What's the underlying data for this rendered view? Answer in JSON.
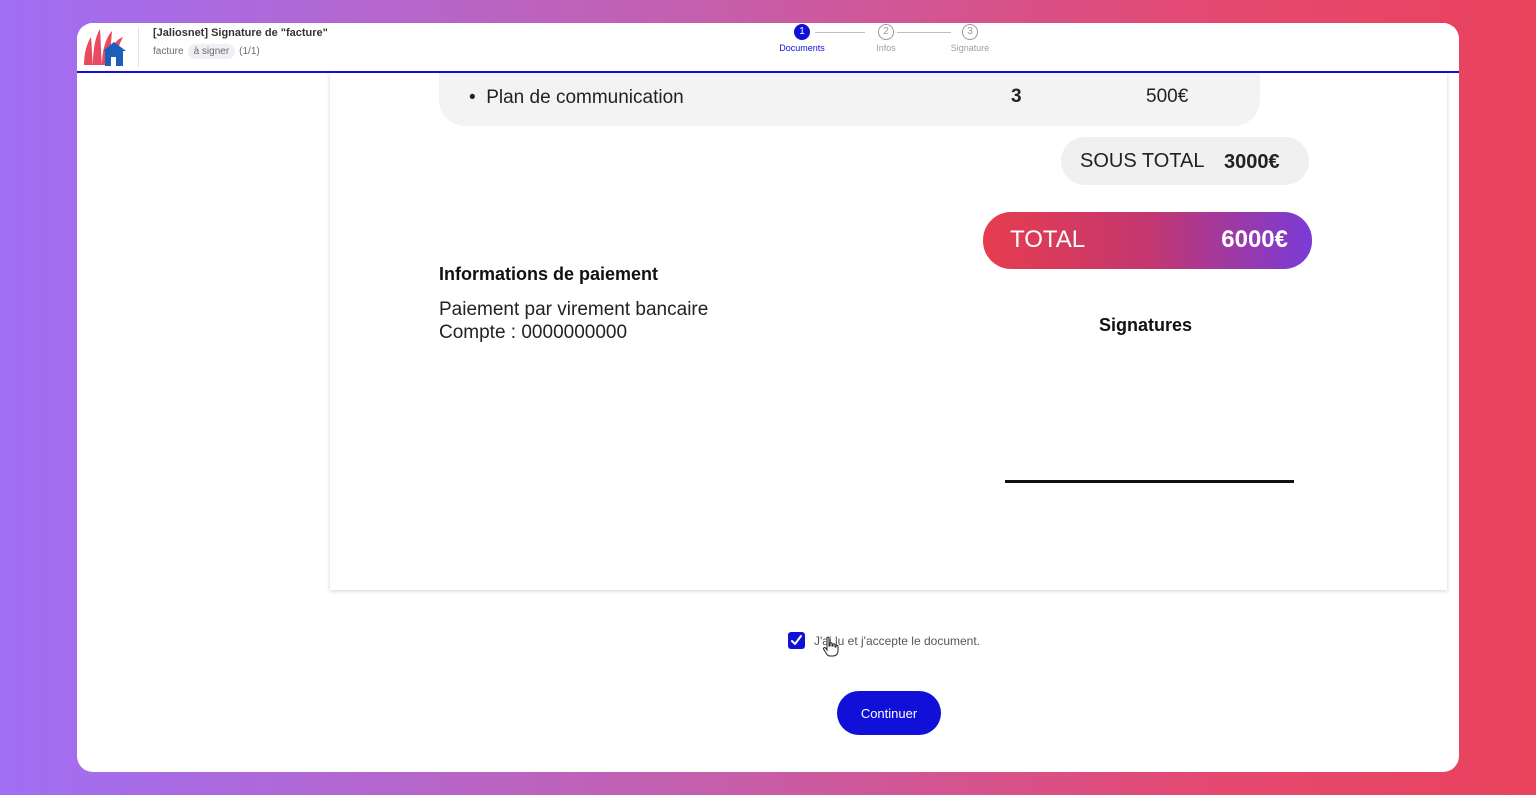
{
  "header": {
    "title": "[Jaliosnet] Signature de \"facture\"",
    "doc_name": "facture",
    "status_badge": "à signer",
    "count": "(1/1)"
  },
  "steps": [
    {
      "number": "1",
      "label": "Documents",
      "active": true
    },
    {
      "number": "2",
      "label": "Infos",
      "active": false
    },
    {
      "number": "3",
      "label": "Signature",
      "active": false
    }
  ],
  "document": {
    "item": {
      "bullet": "•",
      "name": "Plan de communication",
      "qty": "3",
      "price": "500€"
    },
    "subtotal": {
      "label": "SOUS TOTAL",
      "value": "3000€"
    },
    "total": {
      "label": "TOTAL",
      "value": "6000€"
    },
    "payment": {
      "title": "Informations de paiement",
      "line1": "Paiement par virement bancaire",
      "line2": "Compte : 0000000000"
    },
    "signatures_title": "Signatures"
  },
  "accept": {
    "label": "J'ai lu et j'accepte le document.",
    "checked": true
  },
  "continue_label": "Continuer",
  "colors": {
    "primary": "#1010d8",
    "total_gradient_start": "#e73d4e",
    "total_gradient_end": "#7a3bd6"
  }
}
